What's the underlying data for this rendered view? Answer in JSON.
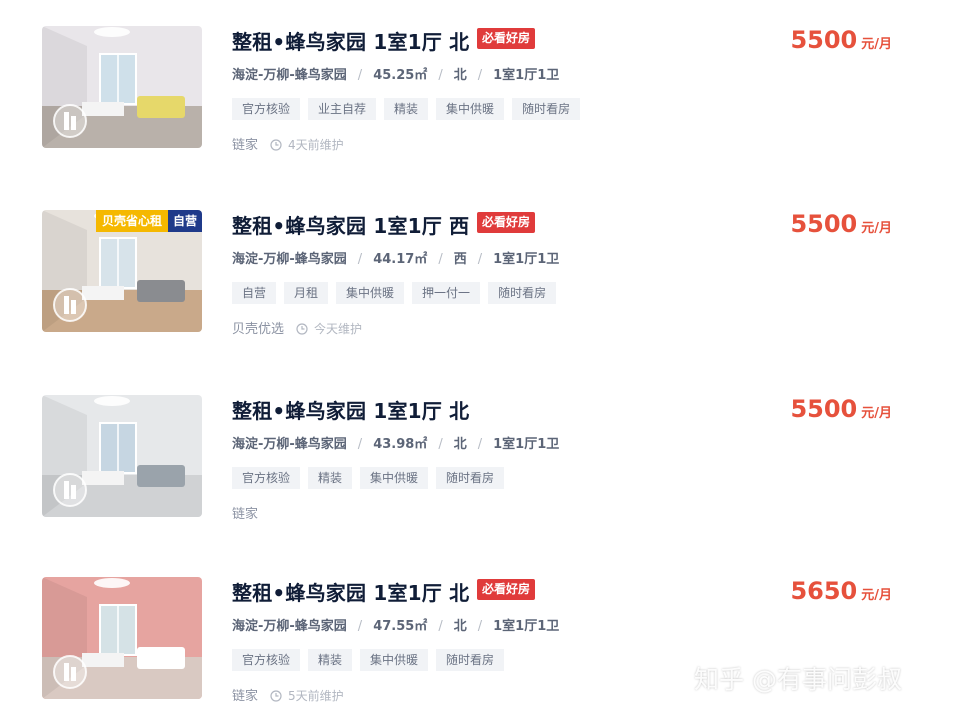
{
  "listings": [
    {
      "title": "整租•蜂鸟家园 1室1厅 北",
      "must_see": "必看好房",
      "district": "海淀-万柳-蜂鸟家园",
      "area": "45.25㎡",
      "orientation": "北",
      "layout": "1室1厅1卫",
      "tags": [
        "官方核验",
        "业主自荐",
        "精装",
        "集中供暖",
        "随时看房"
      ],
      "source": "链家",
      "maintained": "4天前维护",
      "price": "5500",
      "unit": "元/月",
      "badge": null
    },
    {
      "title": "整租•蜂鸟家园 1室1厅 西",
      "must_see": "必看好房",
      "district": "海淀-万柳-蜂鸟家园",
      "area": "44.17㎡",
      "orientation": "西",
      "layout": "1室1厅1卫",
      "tags": [
        "自营",
        "月租",
        "集中供暖",
        "押一付一",
        "随时看房"
      ],
      "source": "贝壳优选",
      "maintained": "今天维护",
      "price": "5500",
      "unit": "元/月",
      "badge": {
        "left": "贝壳省心租",
        "right": "自营"
      }
    },
    {
      "title": "整租•蜂鸟家园 1室1厅 北",
      "must_see": null,
      "district": "海淀-万柳-蜂鸟家园",
      "area": "43.98㎡",
      "orientation": "北",
      "layout": "1室1厅1卫",
      "tags": [
        "官方核验",
        "精装",
        "集中供暖",
        "随时看房"
      ],
      "source": "链家",
      "maintained": null,
      "price": "5500",
      "unit": "元/月",
      "badge": null
    },
    {
      "title": "整租•蜂鸟家园 1室1厅 北",
      "must_see": "必看好房",
      "district": "海淀-万柳-蜂鸟家园",
      "area": "47.55㎡",
      "orientation": "北",
      "layout": "1室1厅1卫",
      "tags": [
        "官方核验",
        "精装",
        "集中供暖",
        "随时看房"
      ],
      "source": "链家",
      "maintained": "5天前维护",
      "price": "5650",
      "unit": "元/月",
      "badge": null
    }
  ],
  "watermark": "知乎 @有事问彭叔",
  "colors": {
    "title": "#101d37",
    "price": "#e6513c",
    "must_see_bg": "#e03b3b",
    "tag_bg": "#f1f3f6",
    "badge_yellow": "#f5b800",
    "badge_navy": "#1f3a8a"
  }
}
